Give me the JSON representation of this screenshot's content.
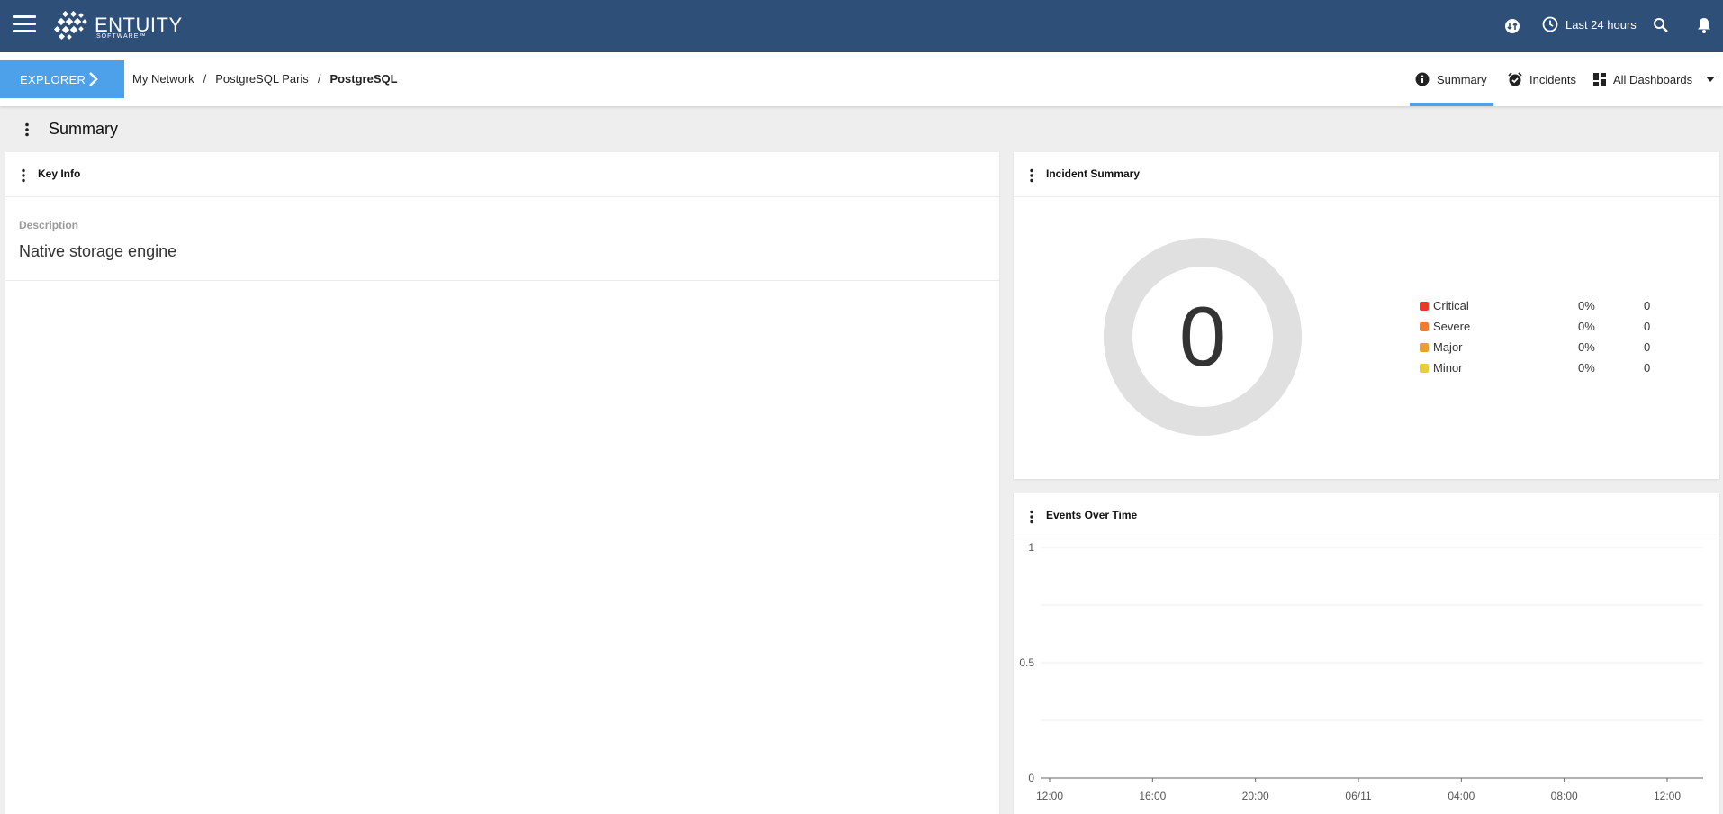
{
  "header": {
    "brand_name": "ENTUITY",
    "brand_sub": "SOFTWARE™",
    "time_range": "Last 24 hours"
  },
  "nav": {
    "explorer_label": "EXPLORER",
    "breadcrumb": [
      "My Network",
      "PostgreSQL Paris",
      "PostgreSQL"
    ],
    "separator": "/",
    "tabs": {
      "summary": "Summary",
      "incidents": "Incidents",
      "dashboards": "All Dashboards"
    }
  },
  "page": {
    "title": "Summary"
  },
  "key_info": {
    "title": "Key Info",
    "description_label": "Description",
    "description_value": "Native storage engine"
  },
  "incident_summary": {
    "title": "Incident Summary",
    "total": "0",
    "legend": [
      {
        "name": "Critical",
        "pct": "0%",
        "count": "0",
        "color": "#e8392b"
      },
      {
        "name": "Severe",
        "pct": "0%",
        "count": "0",
        "color": "#f07d2f"
      },
      {
        "name": "Major",
        "pct": "0%",
        "count": "0",
        "color": "#eaa030"
      },
      {
        "name": "Minor",
        "pct": "0%",
        "count": "0",
        "color": "#e8cf3a"
      }
    ],
    "ring_color": "#e0e0e0"
  },
  "events_over_time": {
    "title": "Events Over Time"
  },
  "chart_data": {
    "type": "line",
    "title": "Events Over Time",
    "x": [
      "12:00",
      "16:00",
      "20:00",
      "06/11",
      "04:00",
      "08:00",
      "12:00"
    ],
    "yticks": [
      "0",
      "0.5",
      "1"
    ],
    "ylim": [
      0,
      1
    ],
    "series": [],
    "grid": true
  },
  "colors": {
    "topbar": "#2e4f78",
    "accent": "#4da0ea"
  }
}
